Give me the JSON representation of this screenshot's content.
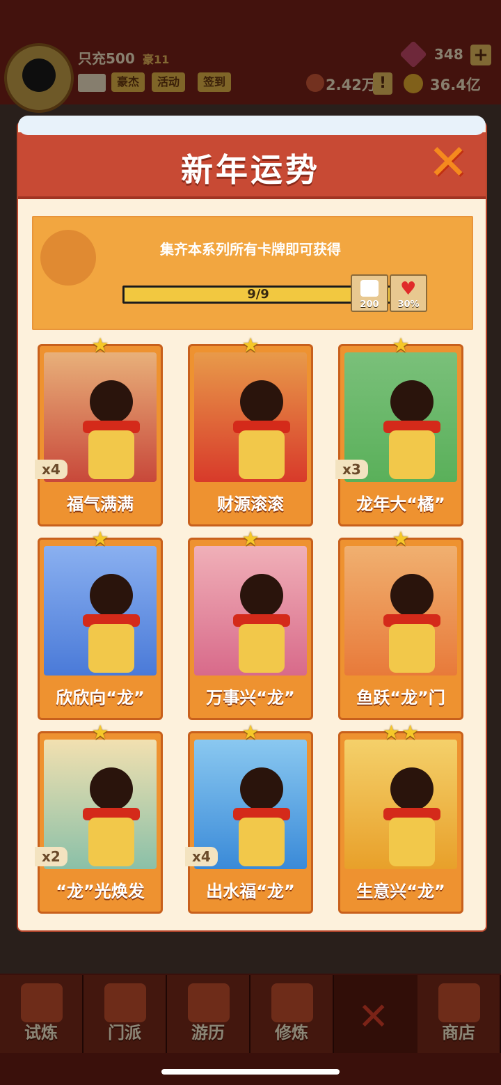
{
  "hud": {
    "player_name": "只充500",
    "vip": "豪11",
    "tags": [
      "豪杰",
      "活动",
      "签到"
    ],
    "gems": "348",
    "resource": "2.42万",
    "coins": "36.4亿",
    "plus": "+",
    "alert": "!"
  },
  "nav": {
    "items": [
      "试炼",
      "门派",
      "游历",
      "修炼"
    ],
    "close": "✕",
    "shop": "商店"
  },
  "modal": {
    "title": "新年运势",
    "close_icon": "✕",
    "banner_text": "集齐本系列所有卡牌即可获得",
    "progress": {
      "text": "9/9",
      "current": 9,
      "total": 9
    },
    "rewards": [
      {
        "icon": "dice-icon",
        "label": "200"
      },
      {
        "icon": "heart-icon",
        "label": "30%"
      }
    ]
  },
  "cards": [
    {
      "name": "福气满满",
      "stars": 1,
      "count": "x4",
      "art_color": "#c8483a",
      "art_sky": "#e8b07a"
    },
    {
      "name": "财源滚滚",
      "stars": 1,
      "count": "",
      "art_color": "#d83a2a",
      "art_sky": "#e89a4a"
    },
    {
      "name": "龙年大“橘”",
      "stars": 1,
      "count": "x3",
      "art_color": "#5ab05a",
      "art_sky": "#7ac07a"
    },
    {
      "name": "欣欣向“龙”",
      "stars": 1,
      "count": "",
      "art_color": "#4a7ad8",
      "art_sky": "#8ab0f0"
    },
    {
      "name": "万事兴“龙”",
      "stars": 1,
      "count": "",
      "art_color": "#d86a8a",
      "art_sky": "#f0b0b8"
    },
    {
      "name": "鱼跃“龙”门",
      "stars": 1,
      "count": "",
      "art_color": "#e87a3a",
      "art_sky": "#f0b070"
    },
    {
      "name": "“龙”光焕发",
      "stars": 1,
      "count": "x2",
      "art_color": "#8ac0a8",
      "art_sky": "#f2e0b0"
    },
    {
      "name": "出水福“龙”",
      "stars": 1,
      "count": "x4",
      "art_color": "#3a8ad8",
      "art_sky": "#8ac8f0"
    },
    {
      "name": "生意兴“龙”",
      "stars": 2,
      "count": "",
      "art_color": "#e8a02a",
      "art_sky": "#f4d06a"
    }
  ]
}
